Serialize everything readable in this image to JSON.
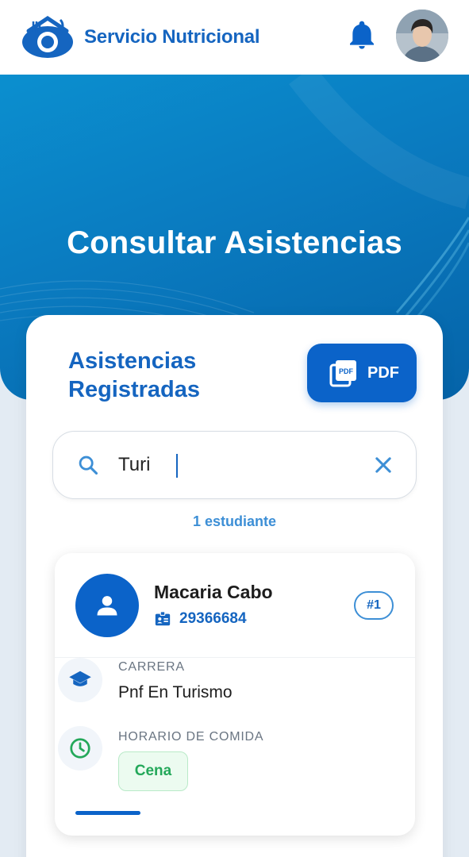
{
  "header": {
    "brand": "Servicio Nutricional",
    "logo_icon": "restaurant-logo-icon",
    "bell_icon": "bell-icon",
    "avatar_icon": "user-avatar"
  },
  "hero": {
    "title": "Consultar Asistencias"
  },
  "card": {
    "heading_line1": "Asistencias",
    "heading_line2": "Registradas",
    "pdf_button": "PDF",
    "search": {
      "value": "Turi",
      "placeholder": ""
    },
    "count": "1 estudiante"
  },
  "student": {
    "name": "Macaria Cabo",
    "id": "29366684",
    "rank": "#1",
    "career_label": "CARRERA",
    "career": "Pnf En Turismo",
    "meal_label": "HORARIO DE COMIDA",
    "meal": "Cena"
  },
  "colors": {
    "primary": "#1565c0",
    "button": "#0b63c9",
    "hero": "#0a7bc0",
    "success": "#24a85a"
  }
}
